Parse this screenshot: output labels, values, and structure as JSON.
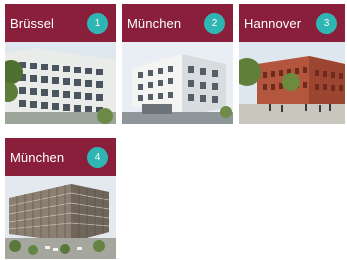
{
  "theme": {
    "header_color": "#8a1f3b",
    "badge_color": "#2fb5b3"
  },
  "projects": [
    {
      "city": "Brüssel",
      "number": "1",
      "image": "office-building-brussels"
    },
    {
      "city": "München",
      "number": "2",
      "image": "white-residential-building-munich"
    },
    {
      "city": "Hannover",
      "number": "3",
      "image": "red-brick-building-hannover"
    },
    {
      "city": "München",
      "number": "4",
      "image": "aerial-office-complex-munich"
    }
  ]
}
